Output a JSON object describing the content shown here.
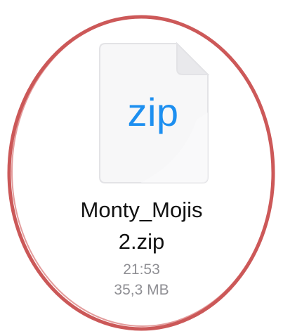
{
  "file": {
    "icon": "zip-document-icon",
    "extension_label": "zip",
    "name_line1": "Monty_Mojis",
    "name_line2": "2.zip",
    "time": "21:53",
    "size": "35,3 MB"
  },
  "colors": {
    "extension": "#1d8ff0",
    "annotation_oval": "#c0392b",
    "meta_text": "#8e8e93",
    "name_text": "#111111"
  }
}
